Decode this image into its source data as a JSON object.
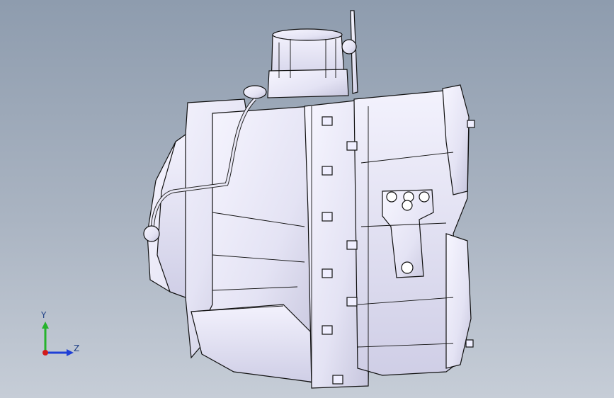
{
  "viewport": {
    "background_top": "#8e9cae",
    "background_bottom": "#c6cdd7"
  },
  "model": {
    "icon": "transmission-assembly-model",
    "body_color": "#e9e8f6",
    "shadow_color": "#c9c8e0",
    "edge_color": "#111111"
  },
  "triad": {
    "y_label": "Y",
    "z_label": "Z",
    "y_color": "#25b32c",
    "z_color": "#1f3fd6",
    "x_color": "#d21a1a"
  }
}
